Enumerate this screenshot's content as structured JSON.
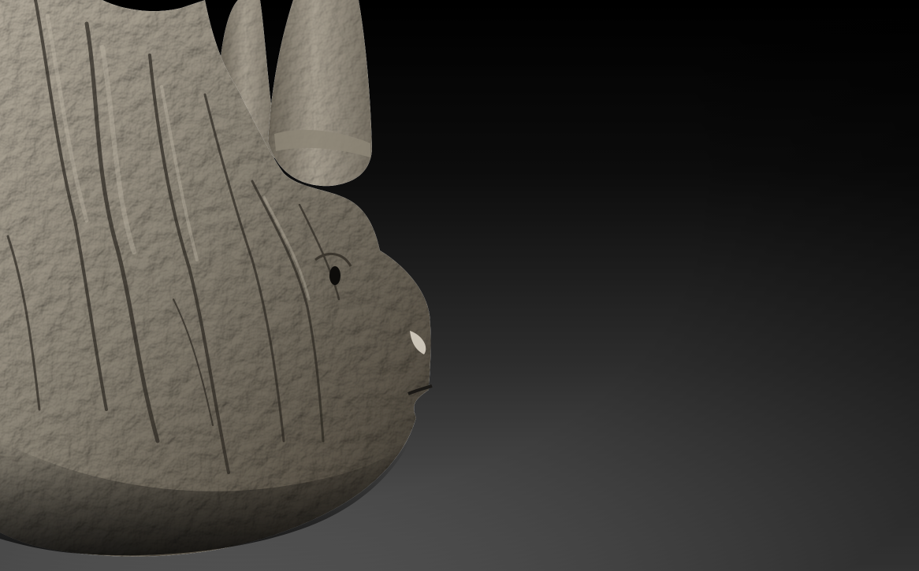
{
  "scene": {
    "subject": "sculpted-rhinoceros-head",
    "background_top_color": "#000000",
    "background_bottom_color": "#5a5a5a",
    "sculpt_base_color": "#8a8375",
    "sculpt_highlight_color": "#b3ab9c",
    "sculpt_shadow_color": "#2f2b25"
  }
}
